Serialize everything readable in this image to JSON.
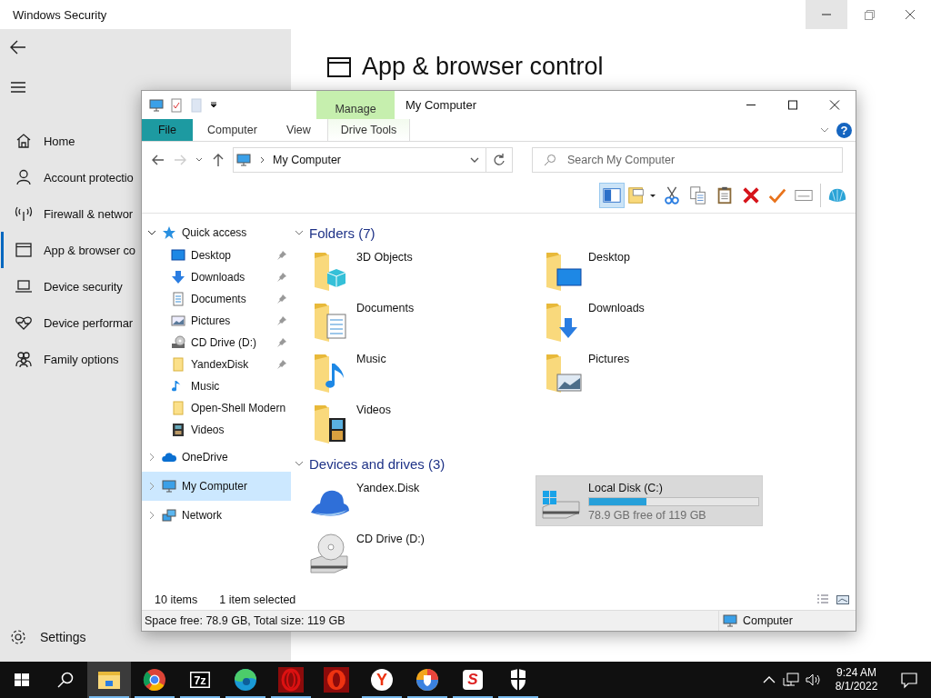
{
  "security": {
    "title": "Windows Security",
    "heading": "App & browser control",
    "nav": [
      {
        "label": "Home",
        "kind": "house",
        "selected": false
      },
      {
        "label": "Account protectio",
        "kind": "person",
        "selected": false
      },
      {
        "label": "Firewall & networ",
        "kind": "antenna",
        "selected": false
      },
      {
        "label": "App & browser co",
        "kind": "window",
        "selected": true
      },
      {
        "label": "Device security",
        "kind": "laptop",
        "selected": false
      },
      {
        "label": "Device performar",
        "kind": "heart",
        "selected": false
      },
      {
        "label": "Family options",
        "kind": "people",
        "selected": false
      }
    ],
    "settings": "Settings"
  },
  "explorer": {
    "title": "My Computer",
    "context_tab": "Manage",
    "tabs": [
      {
        "label": "File",
        "kind": "file",
        "selected": false
      },
      {
        "label": "Computer",
        "kind": "plain",
        "selected": false
      },
      {
        "label": "View",
        "kind": "plain",
        "selected": false
      },
      {
        "label": "Drive Tools",
        "kind": "context",
        "selected": false
      }
    ],
    "help": "?",
    "address": "My Computer",
    "search": {
      "placeholder": "Search My Computer"
    },
    "toolbar": [
      {
        "kind": "pane",
        "selected": true
      },
      {
        "kind": "note-folder",
        "selected": false
      },
      {
        "kind": "scissors",
        "selected": false
      },
      {
        "kind": "copy",
        "selected": false
      },
      {
        "kind": "clipboard",
        "selected": false
      },
      {
        "kind": "cross",
        "selected": false
      },
      {
        "kind": "tick",
        "selected": false
      },
      {
        "kind": "card",
        "selected": false
      },
      {
        "kind": "shell",
        "selected": false
      }
    ],
    "nav": [
      {
        "label": "Quick access",
        "kind": "star",
        "expanded": true,
        "selected": false,
        "children": [
          {
            "label": "Desktop",
            "kind": "screen",
            "pinned": true,
            "selected": false
          },
          {
            "label": "Downloads",
            "kind": "arrow-down",
            "pinned": true,
            "selected": false
          },
          {
            "label": "Documents",
            "kind": "document",
            "pinned": true,
            "selected": false
          },
          {
            "label": "Pictures",
            "kind": "picture",
            "pinned": true,
            "selected": false
          },
          {
            "label": "CD Drive (D:)",
            "kind": "disc-drive",
            "pinned": true,
            "selected": false
          },
          {
            "label": "YandexDisk",
            "kind": "folder",
            "pinned": true,
            "selected": false
          },
          {
            "label": "Music",
            "kind": "note",
            "pinned": false,
            "selected": false
          },
          {
            "label": "Open-Shell Modern",
            "kind": "folder",
            "pinned": false,
            "selected": false
          },
          {
            "label": "Videos",
            "kind": "film",
            "pinned": false,
            "selected": false
          }
        ]
      },
      {
        "label": "OneDrive",
        "kind": "cloud",
        "expanded": false,
        "selected": false
      },
      {
        "label": "My Computer",
        "kind": "computer",
        "expanded": false,
        "selected": true
      },
      {
        "label": "Network",
        "kind": "network",
        "expanded": false,
        "selected": false
      }
    ],
    "groups": [
      {
        "title": "Folders (7)",
        "expanded": true,
        "items": [
          {
            "name": "3D Objects",
            "kind": "cube-folder",
            "selected": false
          },
          {
            "name": "Desktop",
            "kind": "screen-folder",
            "selected": false
          },
          {
            "name": "Documents",
            "kind": "document-folder",
            "selected": false
          },
          {
            "name": "Downloads",
            "kind": "arrow-folder",
            "selected": false
          },
          {
            "name": "Music",
            "kind": "note-folder",
            "selected": false
          },
          {
            "name": "Pictures",
            "kind": "picture-folder",
            "selected": false
          },
          {
            "name": "Videos",
            "kind": "film-folder",
            "selected": false
          }
        ]
      },
      {
        "title": "Devices and drives (3)",
        "expanded": true,
        "items": [
          {
            "name": "Yandex.Disk",
            "kind": "cloud",
            "selected": false
          },
          {
            "name": "Local Disk (C:)",
            "kind": "disk",
            "selected": true,
            "level": 0.34,
            "detail": "78.9 GB free of 119 GB"
          },
          {
            "name": "CD Drive (D:)",
            "kind": "cd",
            "selected": false
          }
        ]
      }
    ],
    "item_count": "10 items",
    "selection": "1 item selected",
    "status": "Space free: 78.9 GB, Total size: 119 GB",
    "location": "Computer"
  },
  "taskbar": {
    "apps": [
      {
        "kind": "folder",
        "selected": true,
        "running": true
      },
      {
        "kind": "ball",
        "selected": false,
        "running": true
      },
      {
        "kind": "box",
        "glyph": "7z",
        "selected": false,
        "running": true
      },
      {
        "kind": "swirl",
        "selected": false,
        "running": true
      },
      {
        "kind": "ring",
        "selected": false,
        "running": true
      },
      {
        "kind": "ring-filled",
        "selected": false,
        "running": false
      },
      {
        "kind": "letter",
        "glyph": "Y",
        "selected": false,
        "running": true
      },
      {
        "kind": "shield-ball",
        "selected": false,
        "running": true
      },
      {
        "kind": "letter-square",
        "glyph": "S",
        "selected": false,
        "running": true
      },
      {
        "kind": "shield",
        "selected": false,
        "running": true
      }
    ],
    "time": "9:24 AM",
    "date": "8/1/2022"
  }
}
